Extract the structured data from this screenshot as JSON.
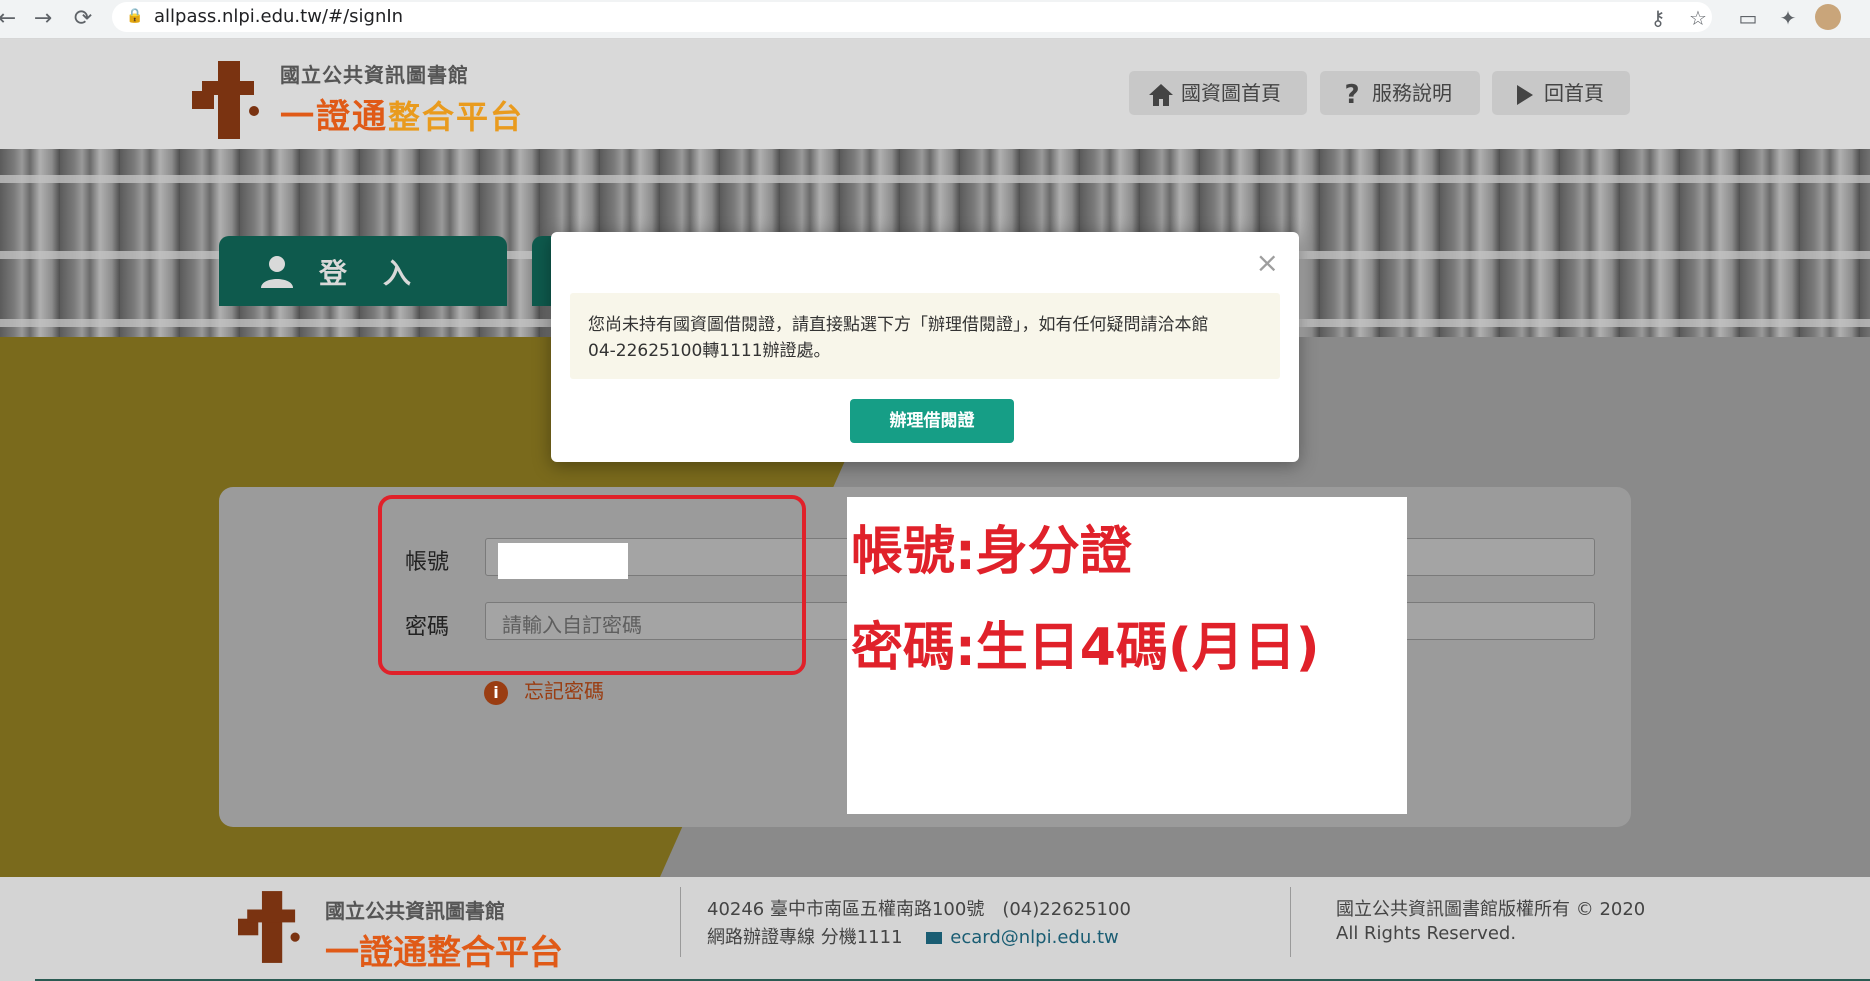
{
  "browser": {
    "back_icon": "←",
    "forward_icon": "→",
    "reload_icon": "⟳",
    "url": "allpass.nlpi.edu.tw/#/signIn"
  },
  "header": {
    "logo_small": "國立公共資訊圖書館",
    "logo_big_main": "一證通",
    "logo_big_sub": "整合平台",
    "nav": [
      {
        "label": "國資圖首頁",
        "icon": "home-icon"
      },
      {
        "label": "服務說明",
        "icon": "question-icon"
      },
      {
        "label": "回首頁",
        "icon": "play-icon"
      }
    ]
  },
  "tabs": {
    "login_label": "登　入"
  },
  "modal": {
    "message_line1": "您尚未持有國資圖借閱證，請直接點選下方「辦理借閱證」，如有任何疑問請洽本館",
    "message_line2": "04-22625100轉1111辦證處。",
    "button_label": "辦理借閱證",
    "close_icon": "×"
  },
  "form": {
    "account_label": "帳號",
    "password_label": "密碼",
    "password_placeholder": "請輸入自訂密碼",
    "forgot_label": "忘記密碼",
    "forgot_icon": "i"
  },
  "annotation": {
    "line1": "帳號:身分證",
    "line2": "密碼:生日4碼(月日)"
  },
  "footer": {
    "logo_small": "國立公共資訊圖書館",
    "logo_big": "一證通整合平台",
    "address": "40246 臺中市南區五權南路100號　(04)22625100",
    "hotline": "網路辦證專線 分機1111",
    "email": "ecard@nlpi.edu.tw",
    "copyright": "國立公共資訊圖書館版權所有 © 2020",
    "rights": "All Rights Reserved."
  }
}
